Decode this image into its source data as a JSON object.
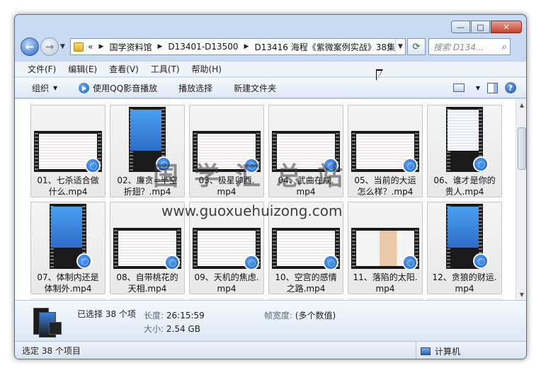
{
  "window": {
    "minimize": "—",
    "maximize": "□",
    "close": "✕"
  },
  "navigation": {
    "back_icon": "back-arrow-icon",
    "forward_icon": "forward-arrow-icon",
    "breadcrumb_overflow": "«",
    "breadcrumbs": [
      "国学资料馆",
      "D13401-D13500",
      "D13416 海程《紫微案例实战》38集"
    ],
    "search_placeholder": "搜索 D134..."
  },
  "menu": [
    "文件(F)",
    "编辑(E)",
    "查看(V)",
    "工具(T)",
    "帮助(H)"
  ],
  "toolbar": {
    "organize": "组织",
    "play_qq": "使用QQ影音播放",
    "play_selection": "播放选择",
    "new_folder": "新建文件夹"
  },
  "files": [
    {
      "name": "01、七杀适合做什么.mp4",
      "line1": "01、七杀适合做",
      "line2": "什么.mp4",
      "thumb": "landscape"
    },
    {
      "name": "02、廉贪=半空折翅？.mp4",
      "line1": "02、廉贪=半空",
      "line2": "折翅？.mp4",
      "thumb": "portrait-blue"
    },
    {
      "name": "03、极星卯酉.mp4",
      "line1": "03、极星卯酉.",
      "line2": "mp4",
      "thumb": "landscape"
    },
    {
      "name": "04、武曲在戌.mp4",
      "line1": "04、武曲在戌.",
      "line2": "mp4",
      "thumb": "landscape"
    },
    {
      "name": "05、当前的大运怎么样？.mp4",
      "line1": "05、当前的大运",
      "line2": "怎么样？.mp4",
      "thumb": "landscape"
    },
    {
      "name": "06、谁才是你的贵人.mp4",
      "line1": "06、谁才是你的",
      "line2": "贵人.mp4",
      "thumb": "portrait"
    },
    {
      "name": "07、体制内还是体制外.mp4",
      "line1": "07、体制内还是",
      "line2": "体制外.mp4",
      "thumb": "portrait-blue"
    },
    {
      "name": "08、自带桃花的天相.mp4",
      "line1": "08、自带桃花的",
      "line2": "天相.mp4",
      "thumb": "landscape"
    },
    {
      "name": "09、天机的焦虑.mp4",
      "line1": "09、天机的焦虑.",
      "line2": "mp4",
      "thumb": "landscape"
    },
    {
      "name": "10、空宫的感情之路.mp4",
      "line1": "10、空宫的感情",
      "line2": "之路.mp4",
      "thumb": "landscape"
    },
    {
      "name": "11、落陷的太阳.mp4",
      "line1": "11、落陷的太阳.",
      "line2": "mp4",
      "thumb": "face"
    },
    {
      "name": "12、贪狼的财运.mp4",
      "line1": "12、贪狼的财运.",
      "line2": "mp4",
      "thumb": "portrait-blue"
    }
  ],
  "watermark": {
    "text": "国学汇总站",
    "url": "www.guoxuehuizong.com"
  },
  "details": {
    "selected": "已选择 38 个项",
    "length_label": "长度:",
    "length_value": "26:15:59",
    "size_label": "大小:",
    "size_value": "2.54 GB",
    "width_label": "帧宽度:",
    "width_value": "(多个数值)"
  },
  "status": {
    "left": "选定 38 个项目",
    "right": "计算机"
  }
}
